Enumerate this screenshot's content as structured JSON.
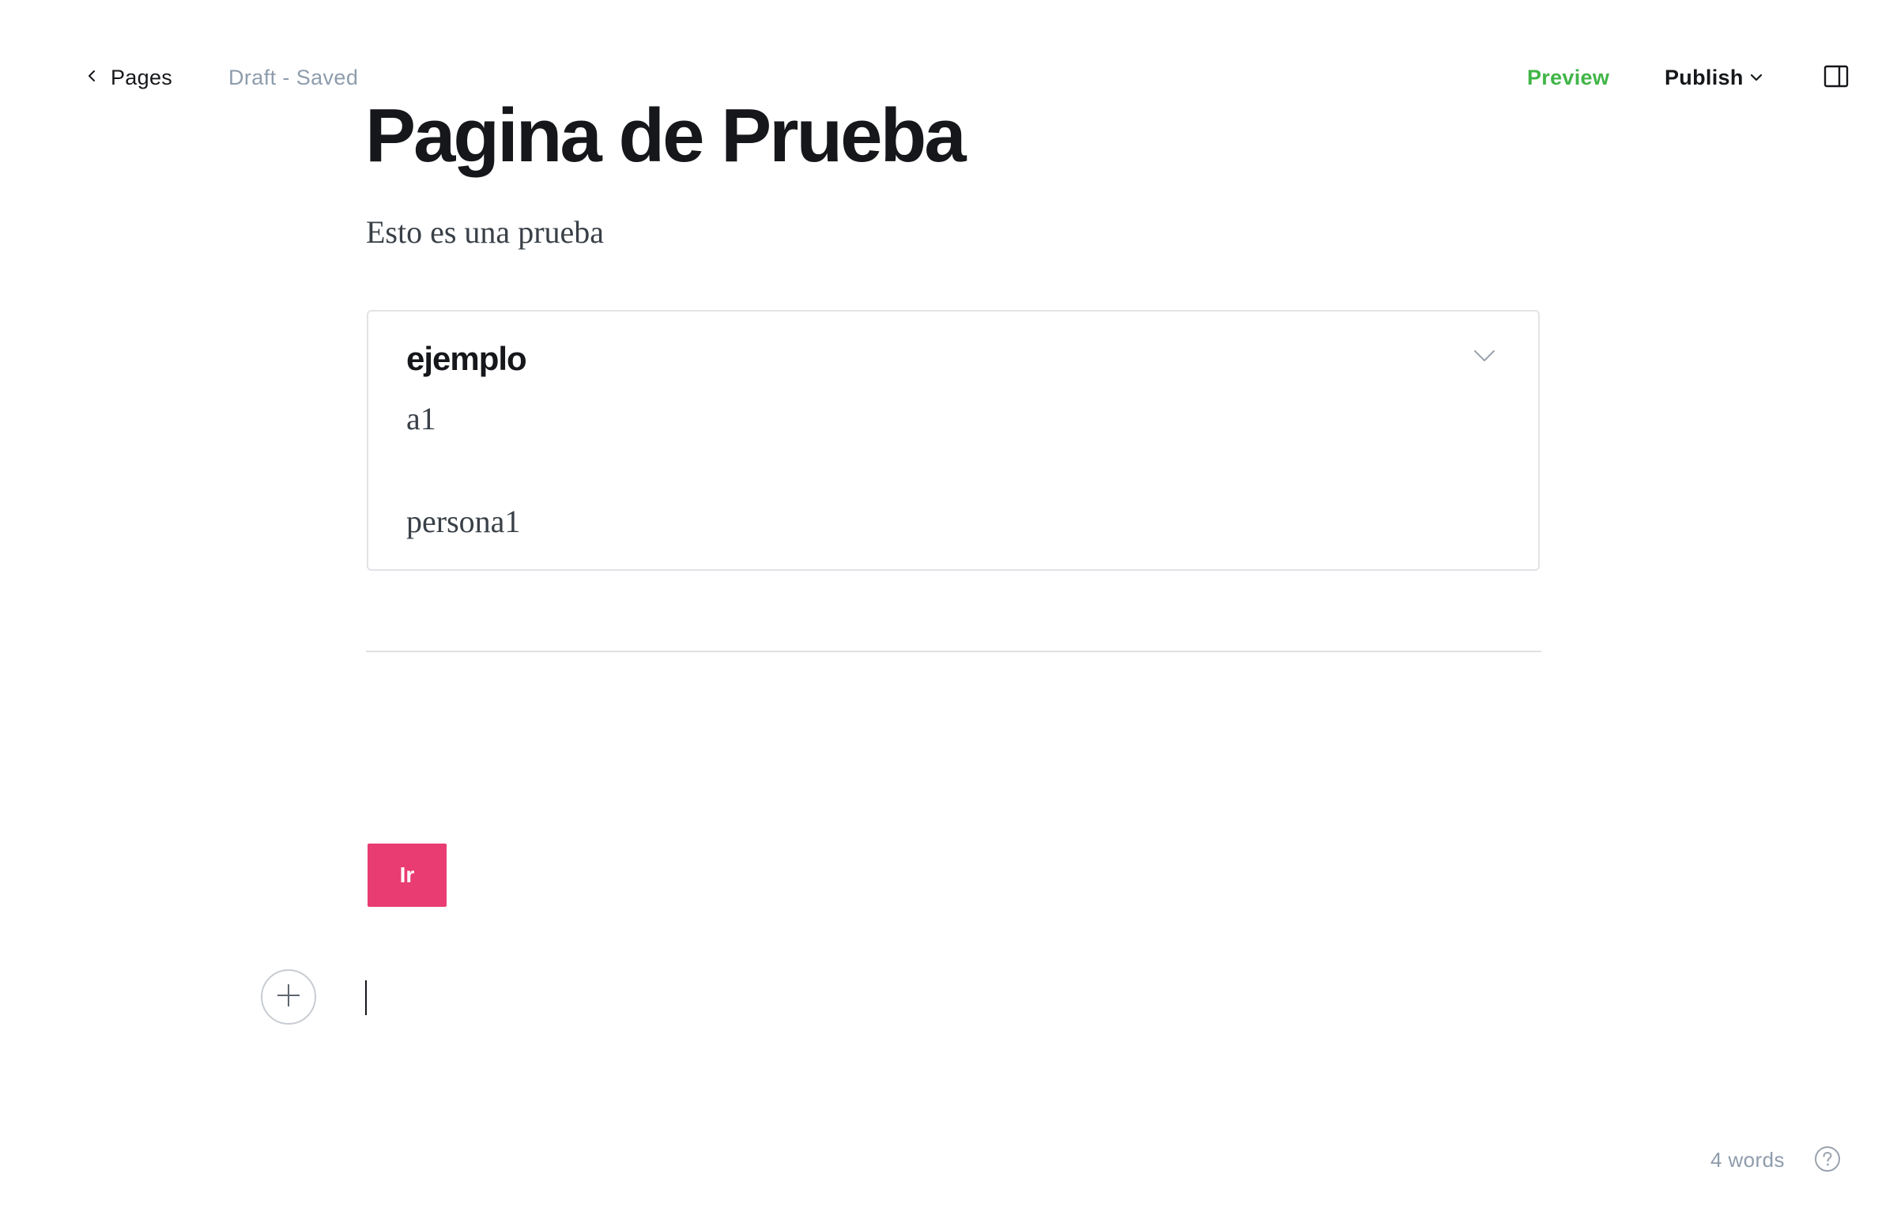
{
  "header": {
    "back_label": "Pages",
    "status": "Draft - Saved",
    "preview_label": "Preview",
    "publish_label": "Publish",
    "icons": {
      "back": "chevron-left-icon",
      "publish_menu": "chevron-down-icon",
      "sidebar": "sidebar-panel-icon"
    }
  },
  "post": {
    "title": "Pagina de Prueba",
    "excerpt": "Esto es una prueba",
    "toggle_card": {
      "heading": "ejemplo",
      "lines": [
        "a1",
        "persona1"
      ],
      "icon": "chevron-down-icon"
    },
    "button_label": "Ir",
    "button_color": "#e93c72",
    "add_card_icon": "plus-icon"
  },
  "footer": {
    "word_count": "4 words",
    "help_icon": "question-mark-icon"
  },
  "colors": {
    "accent_green": "#41b547",
    "muted_text": "#8e9cac",
    "primary_text": "#15171a"
  }
}
